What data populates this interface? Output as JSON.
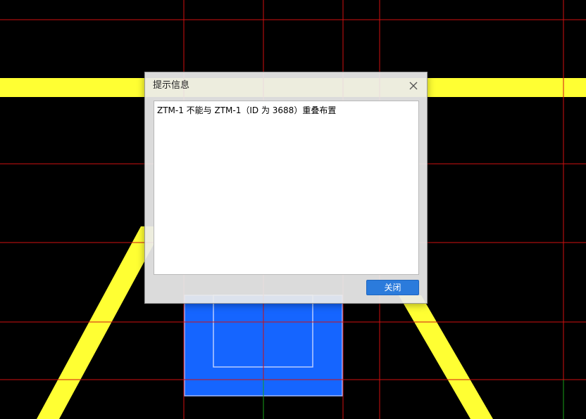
{
  "dialog": {
    "title": "提示信息",
    "message": "ZTM-1 不能与 ZTM-1（ID 为 3688）重叠布置",
    "close_button_label": "关闭",
    "close_icon": "close-icon"
  },
  "colors": {
    "background": "#000000",
    "grid_line": "#d01010",
    "axis_line": "#18a018",
    "beam": "#ffff33",
    "column_fill": "#1565ff",
    "accent_button": "#2b7bdc"
  }
}
